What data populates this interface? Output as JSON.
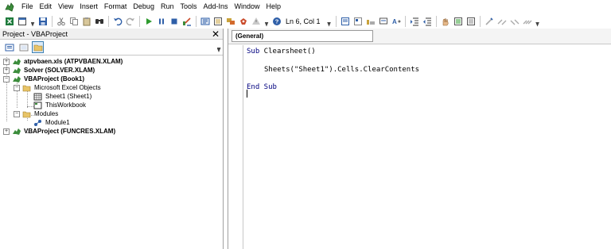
{
  "menu": [
    "File",
    "Edit",
    "View",
    "Insert",
    "Format",
    "Debug",
    "Run",
    "Tools",
    "Add-Ins",
    "Window",
    "Help"
  ],
  "status": {
    "cursor_position": "Ln 6, Col 1"
  },
  "project_explorer": {
    "title": "Project - VBAProject",
    "close_glyph": "✕",
    "tree": [
      {
        "label": "atpvbaen.xls (ATPVBAEN.XLAM)",
        "bold": true,
        "expander": "+"
      },
      {
        "label": "Solver (SOLVER.XLAM)",
        "bold": true,
        "expander": "+"
      },
      {
        "label": "VBAProject (Book1)",
        "bold": true,
        "expander": "−"
      },
      {
        "label": "Microsoft Excel Objects",
        "bold": false,
        "expander": "−"
      },
      {
        "label": "Sheet1 (Sheet1)",
        "bold": false,
        "expander": ""
      },
      {
        "label": "ThisWorkbook",
        "bold": false,
        "expander": ""
      },
      {
        "label": "Modules",
        "bold": false,
        "expander": "−"
      },
      {
        "label": "Module1",
        "bold": false,
        "expander": ""
      },
      {
        "label": "VBAProject (FUNCRES.XLAM)",
        "bold": true,
        "expander": "+"
      }
    ]
  },
  "code_pane": {
    "object_dropdown": "(General)",
    "lines": {
      "sub_keyword": "Sub",
      "sub_name": " Clearsheet()",
      "statement": "Sheets(\"Sheet1\").Cells.ClearContents",
      "end_sub": "End Sub"
    }
  },
  "colors": {
    "keyword": "#00007f",
    "toolbar_bg": "#ffffff",
    "run_green": "#2e9b2e"
  }
}
